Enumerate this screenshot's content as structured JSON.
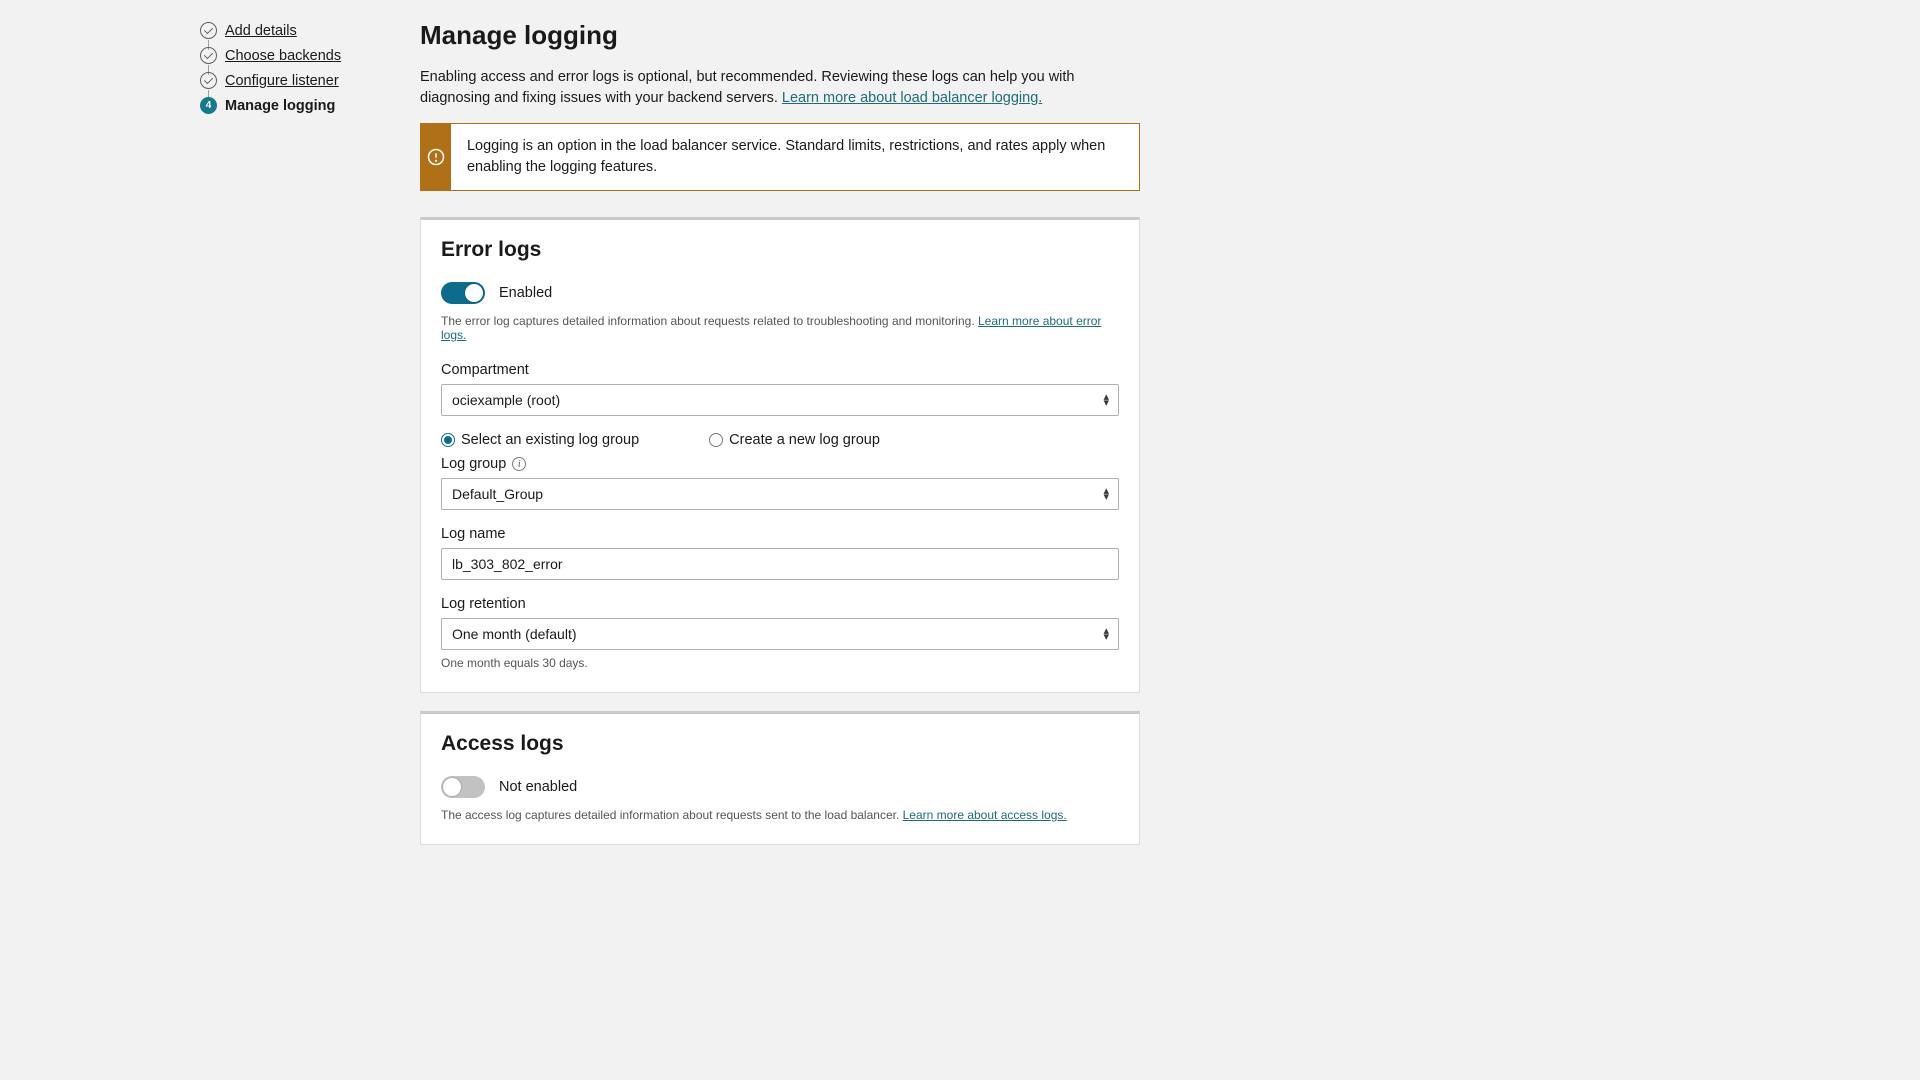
{
  "steps": {
    "items": [
      {
        "label": "Add details"
      },
      {
        "label": "Choose backends"
      },
      {
        "label": "Configure listener"
      },
      {
        "label": "Manage logging",
        "number": "4"
      }
    ]
  },
  "page": {
    "title": "Manage logging",
    "intro_prefix": "Enabling access and error logs is optional, but recommended. Reviewing these logs can help you with diagnosing and fixing issues with your backend servers. ",
    "intro_link": "Learn more about load balancer logging."
  },
  "banner": {
    "text": "Logging is an option in the load balancer service. Standard limits, restrictions, and rates apply when enabling the logging features."
  },
  "error_logs": {
    "title": "Error logs",
    "toggle_state": "Enabled",
    "desc_prefix": "The error log captures detailed information about requests related to troubleshooting and monitoring. ",
    "desc_link": "Learn more about error logs.",
    "compartment_label": "Compartment",
    "compartment_value": "ociexample (root)",
    "radio_existing": "Select an existing log group",
    "radio_create": "Create a new log group",
    "loggroup_label": "Log group",
    "loggroup_value": "Default_Group",
    "logname_label": "Log name",
    "logname_value": "lb_303_802_error",
    "retention_label": "Log retention",
    "retention_value": "One month (default)",
    "retention_help": "One month equals 30 days."
  },
  "access_logs": {
    "title": "Access logs",
    "toggle_state": "Not enabled",
    "desc_prefix": "The access log captures detailed information about requests sent to the load balancer. ",
    "desc_link": "Learn more about access logs."
  }
}
